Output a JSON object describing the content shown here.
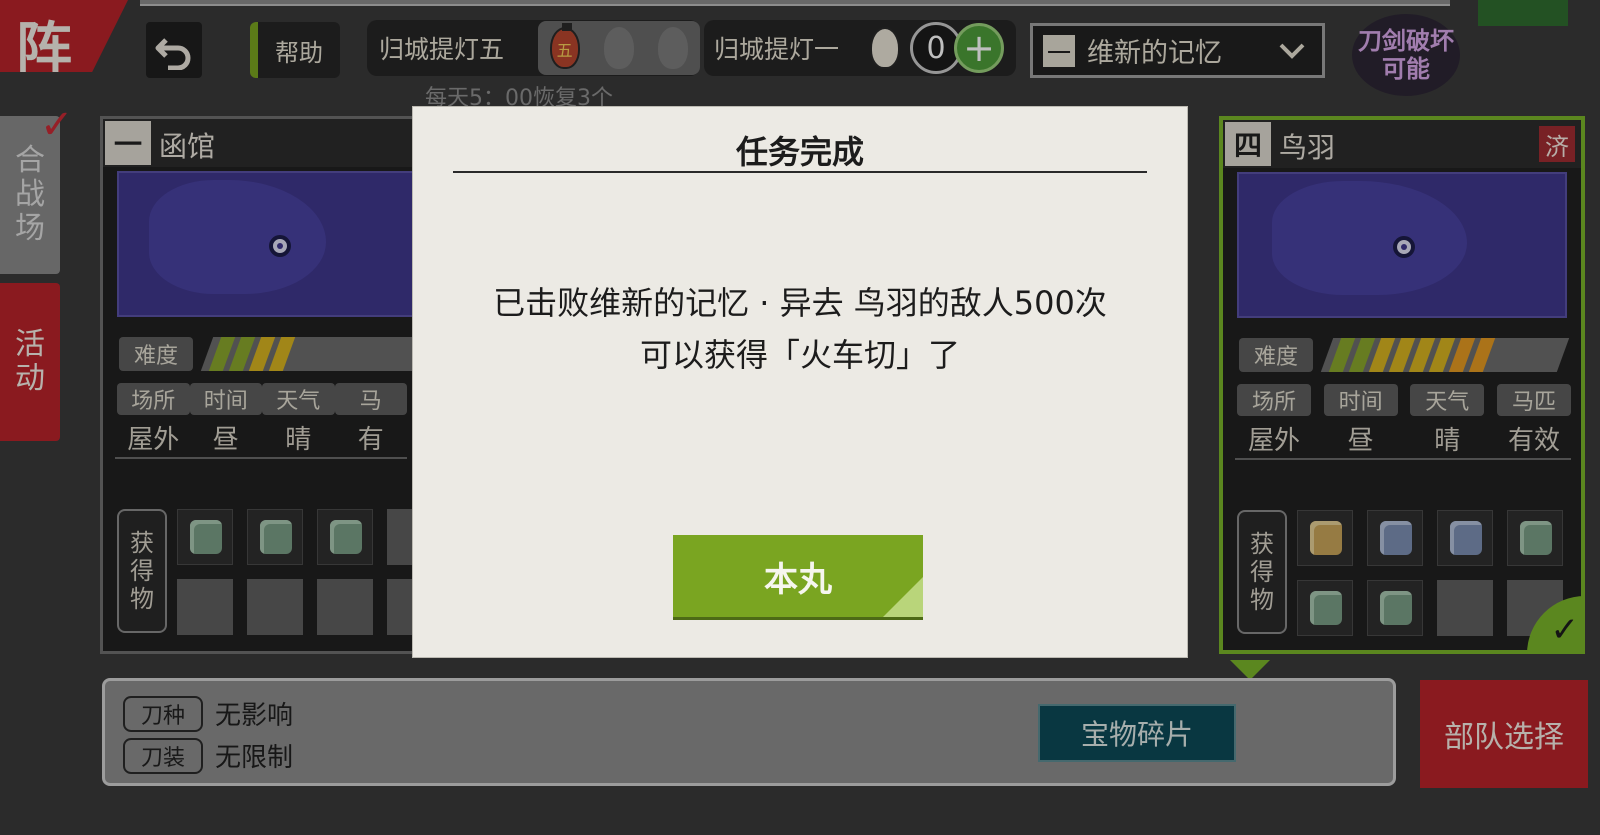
{
  "header": {
    "corner_title": "阵",
    "help_label": "帮助",
    "lantern_five_label": "归城提灯五",
    "lantern_one_label": "归城提灯一",
    "lantern_one_count": "0",
    "era_number": "一",
    "era_label": "维新的记忆",
    "sword_break_line1": "刀剑破坏",
    "sword_break_line2": "可能",
    "daily_note": "每天5：00恢复3个"
  },
  "side_tabs": [
    {
      "label_chars": [
        "合",
        "战",
        "场"
      ]
    },
    {
      "label_chars": [
        "活",
        "动"
      ]
    }
  ],
  "cards": [
    {
      "number": "一",
      "name": "函馆",
      "difficulty_label": "难度",
      "difficulty_level": 4,
      "attributes": [
        {
          "key": "场所",
          "value": "屋外"
        },
        {
          "key": "时间",
          "value": "昼"
        },
        {
          "key": "天气",
          "value": "晴"
        },
        {
          "key": "马",
          "value": "有"
        }
      ],
      "reward_label_chars": [
        "获",
        "得",
        "物"
      ],
      "reward_items": [
        "green",
        "green",
        "green",
        "empty",
        "empty",
        "empty",
        "empty",
        "empty"
      ]
    },
    {
      "number": "四",
      "name": "鸟羽",
      "seal": "济",
      "difficulty_label": "难度",
      "difficulty_level": 8,
      "attributes": [
        {
          "key": "场所",
          "value": "屋外"
        },
        {
          "key": "时间",
          "value": "昼"
        },
        {
          "key": "天气",
          "value": "晴"
        },
        {
          "key": "马匹",
          "value": "有效"
        }
      ],
      "reward_label_chars": [
        "获",
        "得",
        "物"
      ],
      "reward_items": [
        "gold",
        "steel",
        "steel",
        "green",
        "green",
        "green",
        "empty",
        "empty"
      ],
      "selected": true
    }
  ],
  "bottom": {
    "sword_type_tag": "刀种",
    "sword_type_value": "无影响",
    "equipment_tag": "刀装",
    "equipment_value": "无限制",
    "treasure_label": "宝物碎片",
    "squad_label": "部队选择"
  },
  "modal": {
    "title": "任务完成",
    "line1": "已击败维新的记忆 · 异去 鸟羽的敌人500次",
    "line2": "可以获得「火车切」了",
    "button_label": "本丸"
  },
  "colors": {
    "accent_red": "#b8232a",
    "accent_green": "#7aa521",
    "map_purple": "#3f378c"
  }
}
